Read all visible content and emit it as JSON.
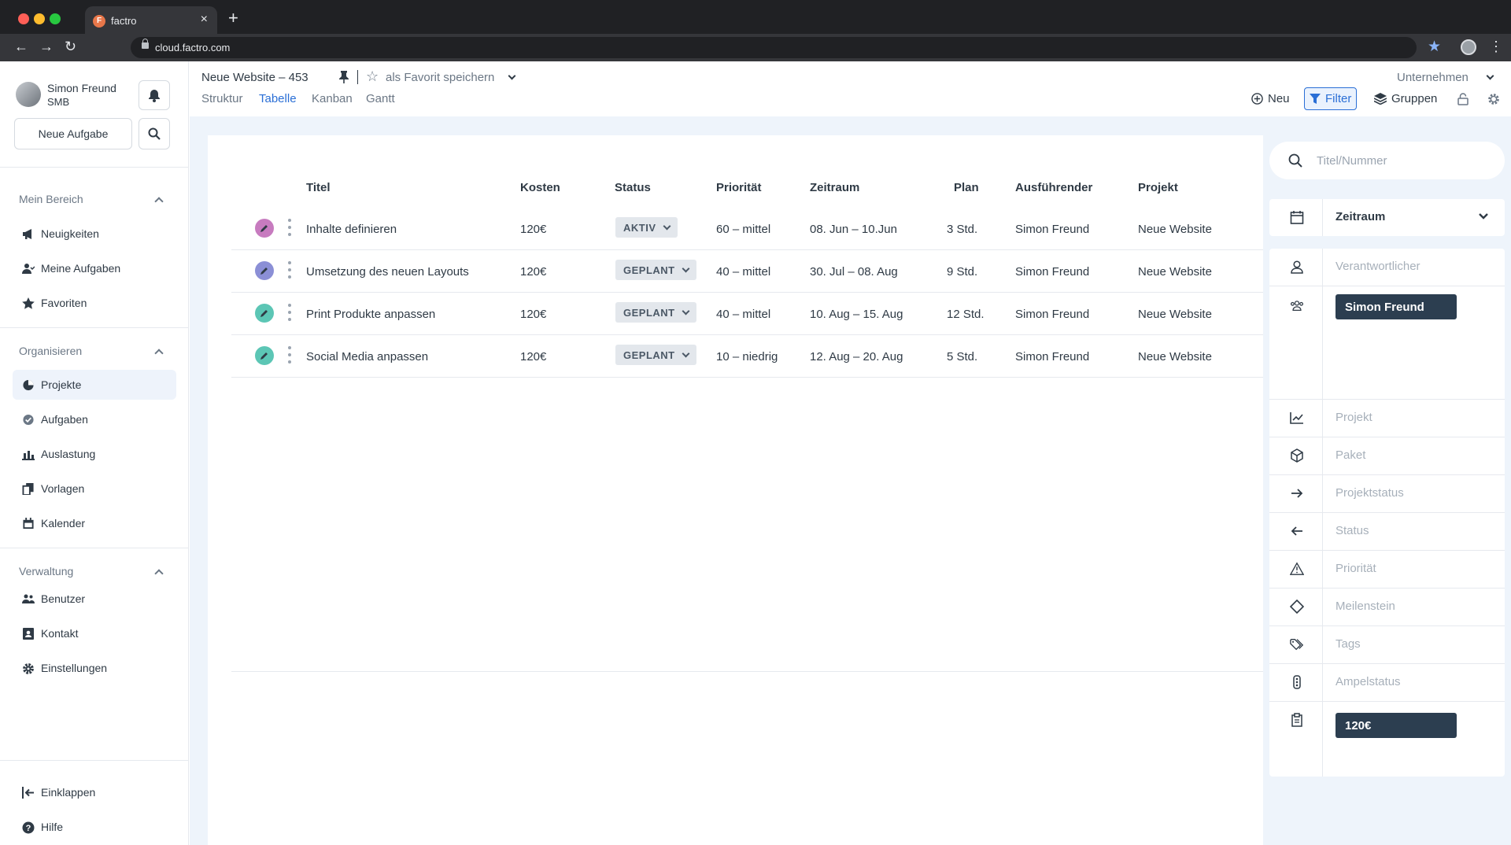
{
  "browser": {
    "tab_title": "factro",
    "tab_favicon": "F",
    "url": "cloud.factro.com"
  },
  "user": {
    "name": "Simon Freund",
    "org": "SMB"
  },
  "sidebar": {
    "new_task_label": "Neue Aufgabe",
    "sections": [
      {
        "title": "Mein Bereich",
        "items": [
          {
            "label": "Neuigkeiten",
            "icon": "megaphone-icon"
          },
          {
            "label": "Meine Aufgaben",
            "icon": "user-check-icon"
          },
          {
            "label": "Favoriten",
            "icon": "star-icon"
          }
        ]
      },
      {
        "title": "Organisieren",
        "items": [
          {
            "label": "Projekte",
            "icon": "pie-chart-icon",
            "active": true
          },
          {
            "label": "Aufgaben",
            "icon": "check-circle-icon"
          },
          {
            "label": "Auslastung",
            "icon": "bar-chart-icon"
          },
          {
            "label": "Vorlagen",
            "icon": "copy-icon"
          },
          {
            "label": "Kalender",
            "icon": "calendar-icon"
          }
        ]
      },
      {
        "title": "Verwaltung",
        "items": [
          {
            "label": "Benutzer",
            "icon": "users-icon"
          },
          {
            "label": "Kontakt",
            "icon": "contact-card-icon"
          },
          {
            "label": "Einstellungen",
            "icon": "gear-icon"
          }
        ]
      }
    ],
    "footer": [
      {
        "label": "Einklappen",
        "icon": "collapse-icon"
      },
      {
        "label": "Hilfe",
        "icon": "help-icon"
      }
    ]
  },
  "header": {
    "breadcrumb": "Neue Website – 453",
    "favorite_label": "als Favorit speichern",
    "view_tabs": [
      "Struktur",
      "Tabelle",
      "Kanban",
      "Gantt"
    ],
    "active_view": "Tabelle",
    "company_label": "Unternehmen",
    "toolbar": {
      "new_label": "Neu",
      "filter_label": "Filter",
      "groups_label": "Gruppen"
    }
  },
  "table": {
    "columns": [
      "Titel",
      "Kosten",
      "Status",
      "Priorität",
      "Zeitraum",
      "Plan",
      "Ausführender",
      "Projekt"
    ],
    "rows": [
      {
        "title": "Inhalte definieren",
        "cost": "120€",
        "status": "AKTIV",
        "priority": "60 – mittel",
        "period": "08. Jun – 10.Jun",
        "plan": "3 Std.",
        "assignee": "Simon Freund",
        "project": "Neue Website",
        "icon_color": "#c77bbf"
      },
      {
        "title": "Umsetzung des neuen Layouts",
        "cost": "120€",
        "status": "GEPLANT",
        "priority": "40 – mittel",
        "period": "30. Jul – 08. Aug",
        "plan": "9 Std.",
        "assignee": "Simon Freund",
        "project": "Neue Website",
        "icon_color": "#8b8fd6"
      },
      {
        "title": "Print Produkte anpassen",
        "cost": "120€",
        "status": "GEPLANT",
        "priority": "40 – mittel",
        "period": "10. Aug – 15. Aug",
        "plan": "12 Std.",
        "assignee": "Simon Freund",
        "project": "Neue Website",
        "icon_color": "#5cc6b5"
      },
      {
        "title": "Social Media anpassen",
        "cost": "120€",
        "status": "GEPLANT",
        "priority": "10 – niedrig",
        "period": "12. Aug – 20. Aug",
        "plan": "5 Std.",
        "assignee": "Simon Freund",
        "project": "Neue Website",
        "icon_color": "#5cc6b5"
      }
    ]
  },
  "filter_panel": {
    "search_placeholder": "Titel/Nummer",
    "zeitraum_label": "Zeitraum",
    "verantwortlicher_label": "Verantwortlicher",
    "assignee_chip": "Simon Freund",
    "fields": [
      "Projekt",
      "Paket",
      "Projektstatus",
      "Status",
      "Priorität",
      "Meilenstein",
      "Tags",
      "Ampelstatus"
    ],
    "cost_chip": "120€"
  },
  "colors": {
    "accent": "#2a6fd6",
    "chip_bg": "#2c3e50",
    "content_bg": "#eef4fb"
  }
}
